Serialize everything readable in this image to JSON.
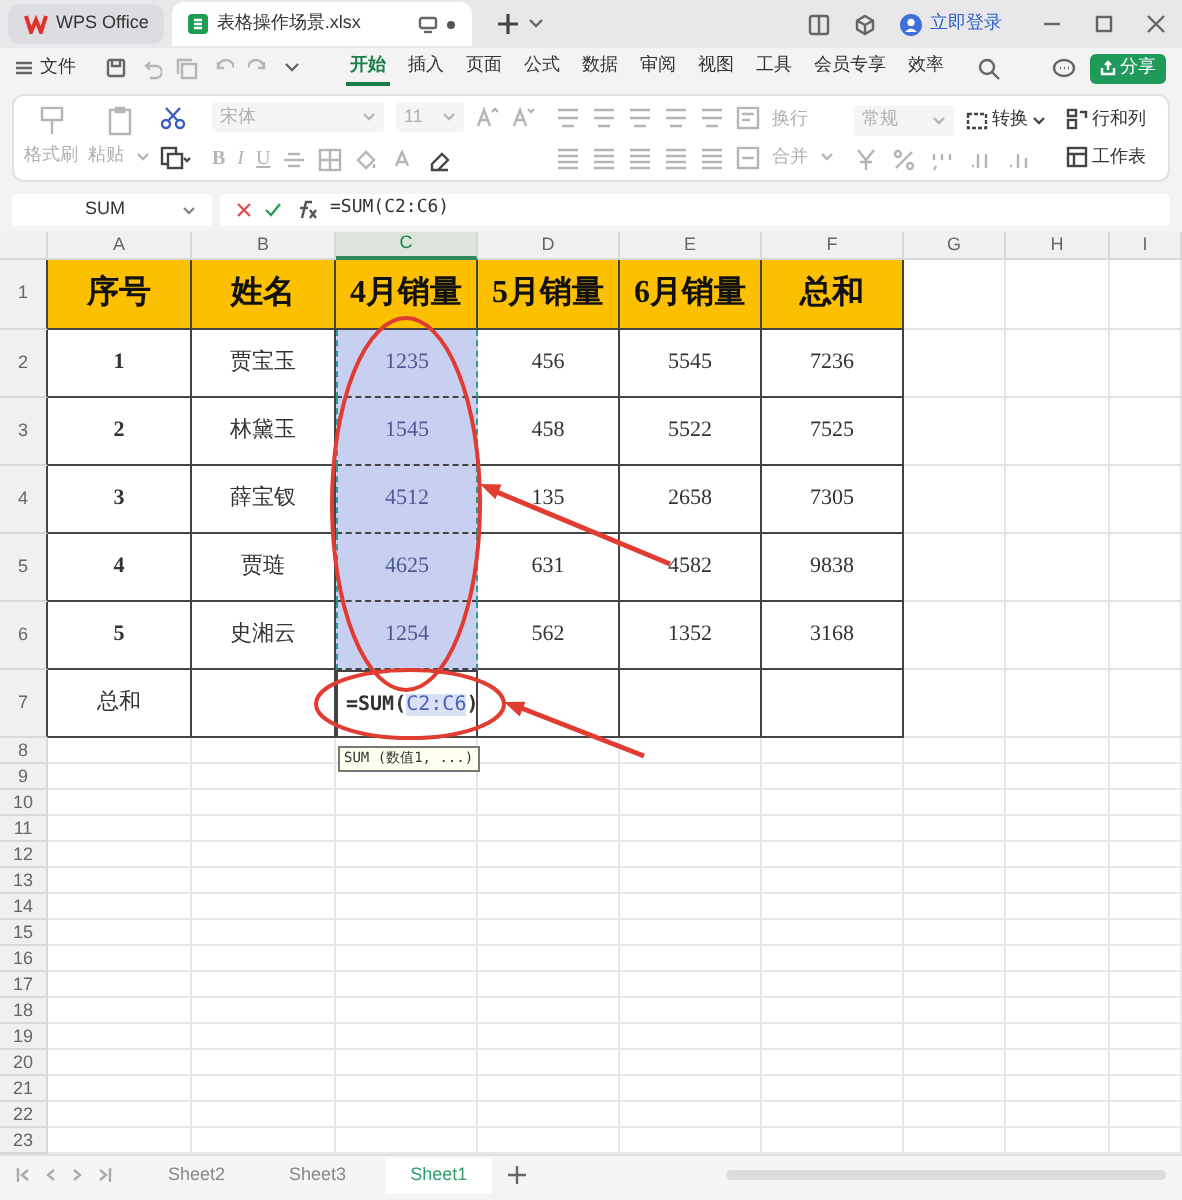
{
  "title_bar": {
    "tabs": [
      {
        "kind": "home",
        "label": "WPS Office",
        "selected": false
      },
      {
        "kind": "document",
        "label": "表格操作场景.xlsx",
        "selected": true
      }
    ],
    "login": "立即登录"
  },
  "menu_bar": {
    "file": "文件",
    "tabs": [
      {
        "label": "开始",
        "selected": true
      },
      {
        "label": "插入",
        "selected": false
      },
      {
        "label": "页面",
        "selected": false
      },
      {
        "label": "公式",
        "selected": false
      },
      {
        "label": "数据",
        "selected": false
      },
      {
        "label": "审阅",
        "selected": false
      },
      {
        "label": "视图",
        "selected": false
      },
      {
        "label": "工具",
        "selected": false
      },
      {
        "label": "会员专享",
        "selected": false
      },
      {
        "label": "效率",
        "selected": false
      }
    ],
    "share": "分享"
  },
  "ribbon": [
    {
      "kind": "clipboard",
      "items": [
        {
          "label": "格式刷",
          "disabled": true
        },
        {
          "label": "粘贴",
          "disabled": true
        }
      ]
    },
    {
      "kind": "font",
      "items": [
        {
          "label": "宋体",
          "disabled": true
        },
        {
          "label": "11",
          "disabled": true
        }
      ],
      "styles": [
        "B",
        "I",
        "U"
      ]
    },
    {
      "kind": "alignment",
      "items": [
        {
          "label": "换行",
          "disabled": true
        },
        {
          "label": "合并",
          "disabled": true
        }
      ]
    },
    {
      "kind": "number",
      "items": [
        {
          "label": "常规",
          "disabled": true
        },
        {
          "label": "转换",
          "disabled": false
        }
      ]
    },
    {
      "kind": "cells",
      "items": [
        {
          "label": "行和列",
          "disabled": false
        },
        {
          "label": "工作表",
          "disabled": false
        }
      ]
    }
  ],
  "formula_bar": {
    "name_box": "SUM",
    "formula": "=SUM(C2:C6)"
  },
  "sheet": {
    "columns": [
      {
        "label": "A",
        "selected": false
      },
      {
        "label": "B",
        "selected": false
      },
      {
        "label": "C",
        "selected": true
      },
      {
        "label": "D",
        "selected": false
      },
      {
        "label": "E",
        "selected": false
      },
      {
        "label": "F",
        "selected": false
      },
      {
        "label": "G",
        "selected": false
      },
      {
        "label": "H",
        "selected": false
      },
      {
        "label": "I",
        "selected": false
      }
    ],
    "rows": [
      {
        "number": "1",
        "kind": "header",
        "cells": [
          {
            "text": "序号",
            "selected": false
          },
          {
            "text": "姓名",
            "selected": false
          },
          {
            "text": "4月销量",
            "selected": false
          },
          {
            "text": "5月销量",
            "selected": false
          },
          {
            "text": "6月销量",
            "selected": false
          },
          {
            "text": "总和",
            "selected": false
          }
        ]
      },
      {
        "number": "2",
        "kind": "data",
        "cells": [
          {
            "text": "1",
            "selected": false
          },
          {
            "text": "贾宝玉",
            "selected": false
          },
          {
            "text": "1235",
            "selected": true
          },
          {
            "text": "456",
            "selected": false
          },
          {
            "text": "5545",
            "selected": false
          },
          {
            "text": "7236",
            "selected": false
          }
        ]
      },
      {
        "number": "3",
        "kind": "data",
        "cells": [
          {
            "text": "2",
            "selected": false
          },
          {
            "text": "林黛玉",
            "selected": false
          },
          {
            "text": "1545",
            "selected": true
          },
          {
            "text": "458",
            "selected": false
          },
          {
            "text": "5522",
            "selected": false
          },
          {
            "text": "7525",
            "selected": false
          }
        ]
      },
      {
        "number": "4",
        "kind": "data",
        "cells": [
          {
            "text": "3",
            "selected": false
          },
          {
            "text": "薛宝钗",
            "selected": false
          },
          {
            "text": "4512",
            "selected": true
          },
          {
            "text": "135",
            "selected": false
          },
          {
            "text": "2658",
            "selected": false
          },
          {
            "text": "7305",
            "selected": false
          }
        ]
      },
      {
        "number": "5",
        "kind": "data",
        "cells": [
          {
            "text": "4",
            "selected": false
          },
          {
            "text": "贾琏",
            "selected": false
          },
          {
            "text": "4625",
            "selected": true
          },
          {
            "text": "631",
            "selected": false
          },
          {
            "text": "4582",
            "selected": false
          },
          {
            "text": "9838",
            "selected": false
          }
        ]
      },
      {
        "number": "6",
        "kind": "data",
        "cells": [
          {
            "text": "5",
            "selected": false
          },
          {
            "text": "史湘云",
            "selected": false
          },
          {
            "text": "1254",
            "selected": true
          },
          {
            "text": "562",
            "selected": false
          },
          {
            "text": "1352",
            "selected": false
          },
          {
            "text": "3168",
            "selected": false
          }
        ]
      },
      {
        "number": "7",
        "kind": "total",
        "cells": [
          {
            "kind": "text",
            "text": "总和",
            "selected": false
          },
          {
            "kind": "text",
            "selected": false
          },
          {
            "kind": "formula",
            "function": "=SUM(",
            "reference": "C2:C6",
            "closing": ")",
            "tooltip": "SUM (数值1, ...)",
            "selected": false
          },
          {
            "kind": "text",
            "selected": false
          },
          {
            "kind": "text",
            "selected": false
          },
          {
            "kind": "text",
            "selected": false
          }
        ]
      }
    ],
    "empty_rows": [
      "8",
      "9",
      "10",
      "11",
      "12",
      "13",
      "14",
      "15",
      "16",
      "17",
      "18",
      "19",
      "20",
      "21",
      "22",
      "23"
    ]
  },
  "sheet_tabs": [
    {
      "label": "Sheet2",
      "selected": false
    },
    {
      "label": "Sheet3",
      "selected": false
    },
    {
      "label": "Sheet1",
      "selected": true
    }
  ]
}
